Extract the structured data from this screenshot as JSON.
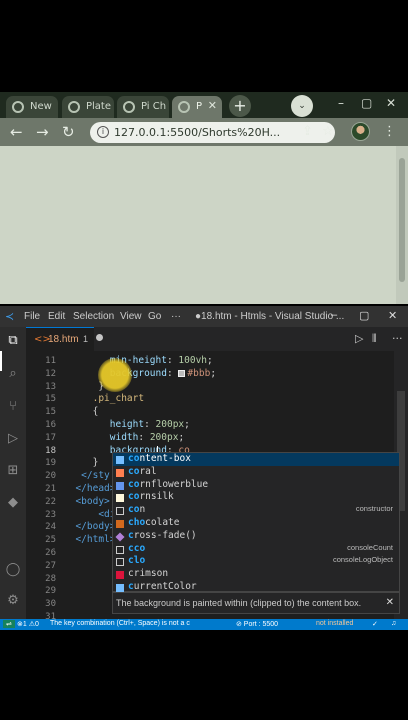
{
  "browser": {
    "tabs": [
      {
        "label": "New",
        "active": false
      },
      {
        "label": "Plate",
        "active": false
      },
      {
        "label": "Pi Ch",
        "active": false
      },
      {
        "label": "P",
        "active": true
      }
    ],
    "new_tab_symbol": "+",
    "tab_menu_symbol": "⌄",
    "window_controls": [
      "–",
      "▢",
      "✕"
    ],
    "url": "127.0.0.1:5500/Shorts%20H...",
    "icons": [
      "back-arrow-icon",
      "forward-arrow-icon",
      "reload-icon",
      "info-icon",
      "share-icon",
      "star-icon",
      "profile-avatar",
      "kebab-menu-icon"
    ]
  },
  "vscode": {
    "menu": [
      "File",
      "Edit",
      "Selection",
      "View",
      "Go",
      "···"
    ],
    "window_title": "●18.htm - Htmls - Visual Studio ...",
    "tab": {
      "name": "18.htm",
      "problems": "1",
      "dirty_icon": "<>"
    },
    "lines": [
      {
        "num": "11",
        "tokens": [
          {
            "t": "        "
          },
          {
            "t": "min-height",
            "c": "prop"
          },
          {
            "t": ": "
          },
          {
            "t": "100vh",
            "c": "num"
          },
          {
            "t": ";"
          }
        ]
      },
      {
        "num": "12",
        "tokens": [
          {
            "t": "        "
          },
          {
            "t": "background",
            "c": "prop"
          },
          {
            "t": ": "
          },
          {
            "swatch": "#bbbbbb"
          },
          {
            "t": "#bbb",
            "c": "val"
          },
          {
            "t": ";"
          }
        ]
      },
      {
        "num": "13",
        "tokens": [
          {
            "t": "      }"
          }
        ]
      },
      {
        "num": "15",
        "tokens": [
          {
            "t": "     "
          },
          {
            "t": ".pi_chart",
            "c": "sel"
          }
        ]
      },
      {
        "num": "15",
        "tokens": [
          {
            "t": "     {"
          }
        ]
      },
      {
        "num": "16",
        "tokens": [
          {
            "t": "        "
          },
          {
            "t": "height",
            "c": "prop"
          },
          {
            "t": ": "
          },
          {
            "t": "200px",
            "c": "num"
          },
          {
            "t": ";"
          }
        ]
      },
      {
        "num": "17",
        "tokens": [
          {
            "t": "        "
          },
          {
            "t": "width",
            "c": "prop"
          },
          {
            "t": ": "
          },
          {
            "t": "200px",
            "c": "num"
          },
          {
            "t": ";"
          }
        ]
      },
      {
        "num": "18",
        "tokens": [
          {
            "t": "        "
          },
          {
            "t": "background",
            "c": "prop"
          },
          {
            "t": ": "
          },
          {
            "t": "co",
            "c": "val"
          }
        ]
      },
      {
        "num": "19",
        "tokens": [
          {
            "t": "     }"
          }
        ]
      },
      {
        "num": "20",
        "tokens": [
          {
            "t": "   </sty",
            "c": "tag"
          }
        ]
      },
      {
        "num": "21",
        "tokens": [
          {
            "t": "  </head>",
            "c": "tag"
          }
        ]
      },
      {
        "num": "22",
        "tokens": [
          {
            "t": "  <body>",
            "c": "tag"
          }
        ]
      },
      {
        "num": "23",
        "tokens": [
          {
            "t": "      <di",
            "c": "tag"
          }
        ]
      },
      {
        "num": "24",
        "tokens": [
          {
            "t": "  </body>",
            "c": "tag"
          }
        ]
      },
      {
        "num": "25",
        "tokens": [
          {
            "t": "  </html>",
            "c": "tag"
          }
        ]
      },
      {
        "num": "26",
        "tokens": []
      },
      {
        "num": "27",
        "tokens": []
      },
      {
        "num": "28",
        "tokens": []
      },
      {
        "num": "29",
        "tokens": []
      },
      {
        "num": "30",
        "tokens": []
      },
      {
        "num": "31",
        "tokens": []
      }
    ],
    "suggestions": [
      {
        "match": "co",
        "rest": "ntent-box",
        "icon": "keyword",
        "detail": "",
        "selected": true
      },
      {
        "match": "co",
        "rest": "ral",
        "icon": "color",
        "color": "#ff7f50",
        "detail": ""
      },
      {
        "match": "co",
        "rest": "rnflowerblue",
        "icon": "color",
        "color": "#6495ed",
        "detail": ""
      },
      {
        "match": "co",
        "rest": "rnsilk",
        "icon": "color",
        "color": "#fff8dc",
        "detail": ""
      },
      {
        "match": "co",
        "rest": "n",
        "icon": "snippet",
        "detail": "constructor"
      },
      {
        "match": "cho",
        "rest": "colate",
        "icon": "color",
        "color": "#d2691e",
        "detail": ""
      },
      {
        "match": "c",
        "rest": "ross-fade()",
        "icon": "function",
        "detail": ""
      },
      {
        "match": "cco",
        "rest": "",
        "icon": "snippet",
        "detail": "consoleCount"
      },
      {
        "match": "clo",
        "rest": "",
        "icon": "snippet",
        "detail": "consoleLogObject"
      },
      {
        "match": "crimson",
        "rest": "",
        "icon": "color",
        "color": "#dc143c",
        "detail": "",
        "style": "plain"
      },
      {
        "match": "c",
        "rest": "urrentColor",
        "icon": "keyword",
        "detail": ""
      }
    ],
    "doc_text": "The background is painted within (clipped to) the content box.",
    "status": {
      "problems": "⊗1 ⚠0",
      "message": "The key combination (Ctrl+, Space) is not a c",
      "port": "⊘ Port : 5500",
      "extension": "not installed"
    }
  },
  "colors": {
    "accent": "#007acc",
    "selection": "#04395e",
    "editor_bg": "#1e1e1e",
    "click_highlight": "#e6c828"
  }
}
